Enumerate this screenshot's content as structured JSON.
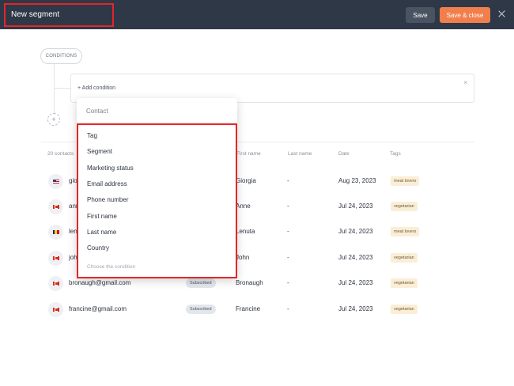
{
  "header": {
    "title": "New segment",
    "save_label": "Save",
    "save_close_label": "Save & close"
  },
  "conditions": {
    "pill_label": "CONDITIONS",
    "add_condition_label": "+ Add condition",
    "plus_label": "+"
  },
  "table": {
    "count_label": "20 contacts",
    "headers": {
      "first_name": "First name",
      "last_name": "Last name",
      "date": "Date",
      "tags": "Tags"
    },
    "rows": [
      {
        "email": "gio",
        "status": "",
        "first_name": "Giorgia",
        "last_name": "-",
        "date": "Aug 23, 2023",
        "tag": "meat lovers",
        "flag": "us"
      },
      {
        "email": "ann",
        "status": "",
        "first_name": "Anne",
        "last_name": "-",
        "date": "Jul 24, 2023",
        "tag": "vegetarian",
        "flag": "ca"
      },
      {
        "email": "len",
        "status": "",
        "first_name": "Lenuta",
        "last_name": "-",
        "date": "Jul 24, 2023",
        "tag": "meat lovers",
        "flag": "ro"
      },
      {
        "email": "joh",
        "status": "",
        "first_name": "John",
        "last_name": "-",
        "date": "Jul 24, 2023",
        "tag": "vegetarian",
        "flag": "ca"
      },
      {
        "email": "bronaugh@gmail.com",
        "status": "Subscribed",
        "first_name": "Bronaugh",
        "last_name": "-",
        "date": "Jul 24, 2023",
        "tag": "vegetarian",
        "flag": "ca"
      },
      {
        "email": "francine@gmail.com",
        "status": "Subscribed",
        "first_name": "Francine",
        "last_name": "-",
        "date": "Jul 24, 2023",
        "tag": "vegetarian",
        "flag": "ca"
      }
    ]
  },
  "dropdown": {
    "header": "Contact",
    "items": [
      "Tag",
      "Segment",
      "Marketing status",
      "Email address",
      "Phone number",
      "First name",
      "Last name",
      "Country"
    ],
    "footer": "Choose the condition"
  },
  "colors": {
    "header_bg": "#2f3847",
    "accent_orange": "#f07f4b",
    "highlight_red": "#e3262a",
    "tag_bg": "#fbeed6"
  }
}
